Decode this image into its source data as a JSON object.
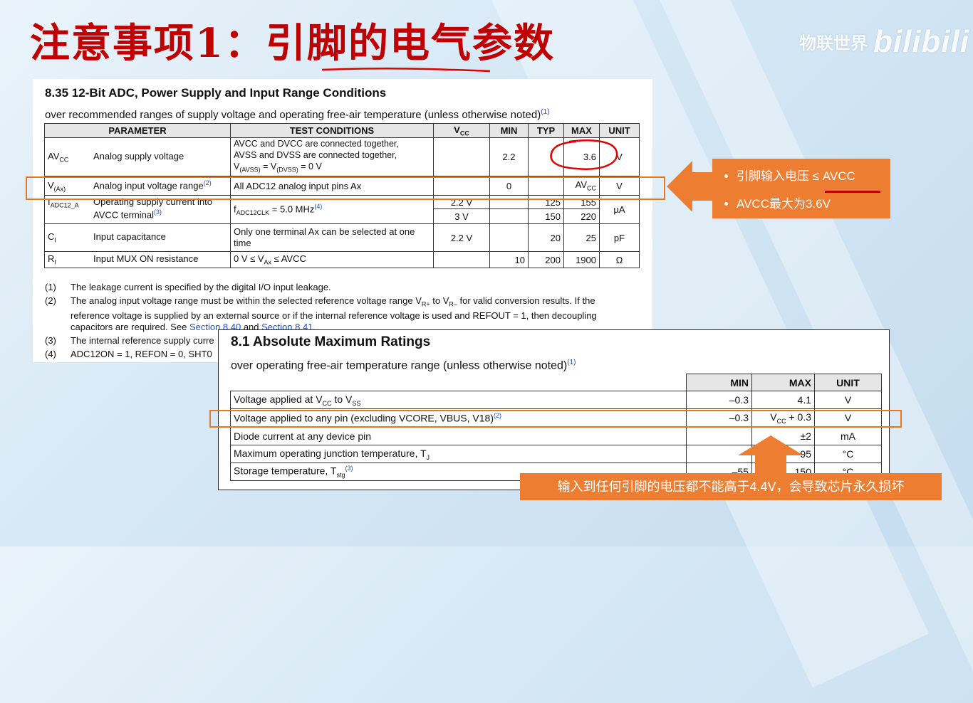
{
  "slide": {
    "title": "注意事项1：引脚的电气参数",
    "watermark_text": "物联世界",
    "watermark_logo": "bilibili"
  },
  "adc_section": {
    "heading": "8.35 12-Bit ADC, Power Supply and Input Range Conditions",
    "subheading": "over recommended ranges of supply voltage and operating free-air temperature (unless otherwise noted)",
    "subheading_note": "(1)",
    "headers": [
      "PARAMETER",
      "TEST CONDITIONS",
      "V",
      "MIN",
      "TYP",
      "MAX",
      "UNIT"
    ],
    "vcc_header_sub": "CC",
    "rows": {
      "avcc": {
        "sym": "AV",
        "sym_sub": "CC",
        "param": "Analog supply voltage",
        "cond": [
          "AVCC and DVCC are connected together,",
          "AVSS and DVSS are connected together,"
        ],
        "cond_formula": {
          "a": "V",
          "a_sub": "(AVSS)",
          "b": " = V",
          "b_sub": "(DVSS)",
          "c": " = 0 V"
        },
        "min": "2.2",
        "max": "3.6",
        "unit": "V"
      },
      "vax": {
        "sym": "V",
        "sym_sub": "(Ax)",
        "param": "Analog input voltage range",
        "param_note": "(2)",
        "cond": "All ADC12 analog input pins Ax",
        "min": "0",
        "max": "AV",
        "max_sub": "CC",
        "unit": "V"
      },
      "iadc": {
        "sym": "I",
        "sym_sub": "ADC12_A",
        "param": [
          "Operating supply current into",
          "AVCC terminal"
        ],
        "param_note": "(3)",
        "cond": "f",
        "cond_sub": "ADC12CLK",
        "cond_rest": " = 5.0 MHz",
        "cond_note": "(4)",
        "vcc1": "2.2 V",
        "typ1": "125",
        "max1": "155",
        "vcc2": "3 V",
        "typ2": "150",
        "max2": "220",
        "unit": "µA"
      },
      "ci": {
        "sym": "C",
        "sym_sub": "I",
        "param": "Input capacitance",
        "cond": [
          "Only one terminal Ax can be selected at one",
          "time"
        ],
        "vcc": "2.2 V",
        "typ": "20",
        "max": "25",
        "unit": "pF"
      },
      "ri": {
        "sym": "R",
        "sym_sub": "I",
        "param": "Input MUX ON resistance",
        "cond_a": "0 V ≤ V",
        "cond_sub": "Ax",
        "cond_b": " ≤ AVCC",
        "min": "10",
        "typ": "200",
        "max": "1900",
        "unit": "Ω"
      }
    },
    "notes": [
      {
        "num": "(1)",
        "text": "The leakage current is specified by the digital I/O input leakage."
      },
      {
        "num": "(2)",
        "text_a": "The analog input voltage range must be within the selected reference voltage range V",
        "sub_a": "R+",
        "text_b": " to V",
        "sub_b": "R–",
        "text_c": " for valid conversion results. If the reference voltage is supplied by an external source or if the internal reference voltage is used and REFOUT = 1, then decoupling capacitors are required. See ",
        "link1": "Section 8.40",
        "and": " and ",
        "link2": "Section 8.41",
        "end": "."
      },
      {
        "num": "(3)",
        "text": "The internal reference supply curre"
      },
      {
        "num": "(4)",
        "text": "ADC12ON = 1, REFON = 0, SHT0"
      }
    ]
  },
  "abs_section": {
    "heading": "8.1 Absolute Maximum Ratings",
    "subheading": "over operating free-air temperature range (unless otherwise noted)",
    "subheading_note": "(1)",
    "headers": [
      "MIN",
      "MAX",
      "UNIT"
    ],
    "rows": [
      {
        "param_a": "Voltage applied at V",
        "sub1": "CC",
        "param_b": " to V",
        "sub2": "SS",
        "min": "–0.3",
        "max": "4.1",
        "unit": "V"
      },
      {
        "param": "Voltage applied to any pin (excluding VCORE, VBUS, V18)",
        "note": "(2)",
        "min": "–0.3",
        "max_a": "V",
        "max_sub": "CC",
        "max_b": " + 0.3",
        "unit": "V"
      },
      {
        "param": "Diode current at any device pin",
        "min": "",
        "max": "±2",
        "unit": "mA"
      },
      {
        "param": "Maximum operating junction temperature, T",
        "sub": "J",
        "min": "",
        "max": "95",
        "unit": "°C"
      },
      {
        "param": "Storage temperature, T",
        "sub": "stg",
        "note": "(3)",
        "min": "–55",
        "max": "150",
        "unit": "°C"
      }
    ]
  },
  "callout_pin": {
    "bullets": [
      "引脚输入电压 ≤ AVCC",
      "AVCC最大为3.6V"
    ]
  },
  "callout_abs": {
    "text": "输入到任何引脚的电压都不能高于4.4V，会导致芯片永久损坏"
  },
  "colors": {
    "title_red": "#c00000",
    "callout_orange": "#ed7d31",
    "highlight_orange": "#e07a28",
    "annotation_red": "#e00000"
  }
}
